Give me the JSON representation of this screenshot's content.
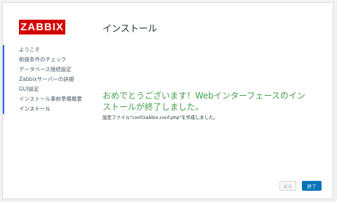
{
  "logo": {
    "text": "ZABBIX"
  },
  "header": {
    "title": "インストール"
  },
  "sidebar": {
    "items": [
      {
        "label": "ようこそ"
      },
      {
        "label": "前提条件のチェック"
      },
      {
        "label": "データベース接続設定"
      },
      {
        "label": "Zabbixサーバーの詳細"
      },
      {
        "label": "GUI設定"
      },
      {
        "label": "インストール事前準備概要"
      },
      {
        "label": "インストール"
      }
    ]
  },
  "main": {
    "success_message": "おめでとうございます！Webインターフェースのインストールが終了しました。",
    "config_message": "設定ファイル\"conf/zabbix.conf.php\"を作成しました。"
  },
  "buttons": {
    "back_label": "戻る",
    "finish_label": "終了"
  },
  "colors": {
    "brand": "#d40000",
    "success": "#429e47",
    "primary": "#0275b8",
    "step_marker": "#1f65f4"
  }
}
